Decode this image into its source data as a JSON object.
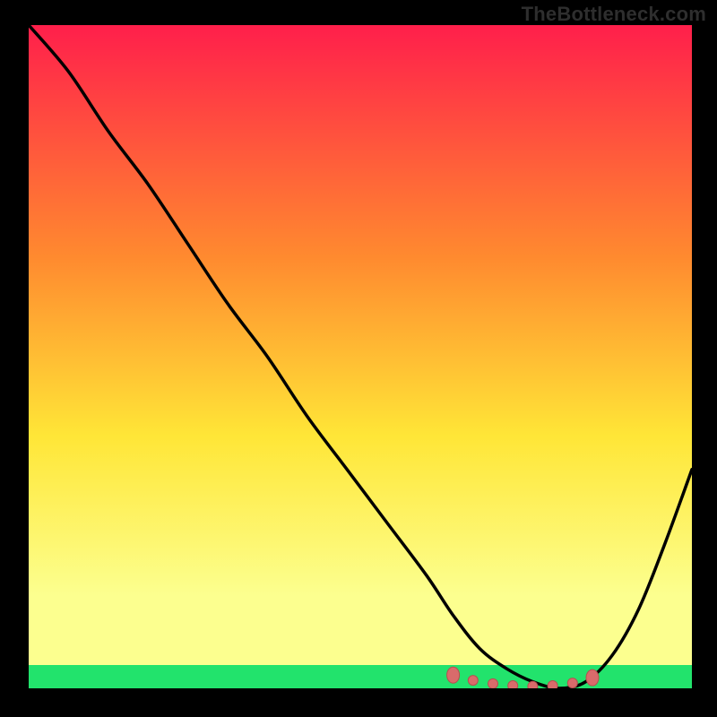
{
  "watermark": "TheBottleneck.com",
  "colors": {
    "background": "#000000",
    "gradient_top": "#ff1f4b",
    "gradient_mid1": "#ff8a2f",
    "gradient_mid2": "#ffe637",
    "gradient_low": "#fcff8f",
    "gradient_green": "#22e36c",
    "curve": "#000000",
    "marker_fill": "#d96b6b",
    "marker_stroke": "#b74f4f"
  },
  "chart_data": {
    "type": "line",
    "title": "",
    "xlabel": "",
    "ylabel": "",
    "xlim": [
      0,
      100
    ],
    "ylim": [
      0,
      100
    ],
    "series": [
      {
        "name": "bottleneck-curve",
        "x": [
          0,
          6,
          12,
          18,
          24,
          30,
          36,
          42,
          48,
          54,
          60,
          64,
          68,
          72,
          76,
          80,
          84,
          88,
          92,
          96,
          100
        ],
        "values": [
          100,
          93,
          84,
          76,
          67,
          58,
          50,
          41,
          33,
          25,
          17,
          11,
          6,
          3,
          1,
          0,
          1,
          5,
          12,
          22,
          33
        ]
      }
    ],
    "markers": {
      "name": "low-bottleneck-band",
      "x": [
        64,
        67,
        70,
        73,
        76,
        79,
        82,
        85
      ],
      "values": [
        2,
        1.2,
        0.7,
        0.4,
        0.3,
        0.4,
        0.8,
        1.6
      ]
    }
  }
}
